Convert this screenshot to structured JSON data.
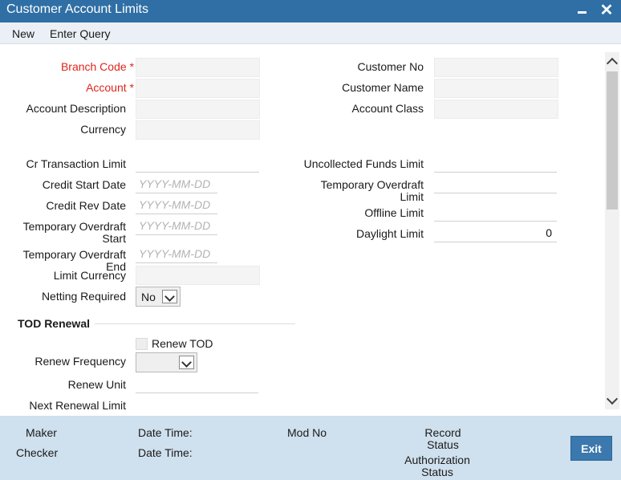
{
  "window": {
    "title": "Customer Account Limits",
    "minimize_icon": "minimize-icon",
    "close_icon": "close-icon",
    "close_glyph": "✕"
  },
  "toolbar": {
    "new_label": "New",
    "enter_query_label": "Enter Query"
  },
  "fields": {
    "branch_code": {
      "label": "Branch Code",
      "required_mark": "*",
      "value": ""
    },
    "account": {
      "label": "Account",
      "required_mark": "*",
      "value": ""
    },
    "account_description": {
      "label": "Account Description",
      "value": ""
    },
    "currency": {
      "label": "Currency",
      "value": ""
    },
    "customer_no": {
      "label": "Customer No",
      "value": ""
    },
    "customer_name": {
      "label": "Customer Name",
      "value": ""
    },
    "account_class": {
      "label": "Account Class",
      "value": ""
    },
    "cr_transaction_limit": {
      "label": "Cr Transaction Limit",
      "value": ""
    },
    "credit_start_date": {
      "label": "Credit Start Date",
      "placeholder": "YYYY-MM-DD"
    },
    "credit_rev_date": {
      "label": "Credit Rev Date",
      "placeholder": "YYYY-MM-DD"
    },
    "temporary_overdraft_start": {
      "label_line1": "Temporary Overdraft",
      "label_line2": "Start",
      "placeholder": "YYYY-MM-DD"
    },
    "temporary_overdraft_end": {
      "label": "Temporary Overdraft End",
      "placeholder": "YYYY-MM-DD"
    },
    "limit_currency": {
      "label": "Limit Currency",
      "value": ""
    },
    "netting_required": {
      "label": "Netting Required",
      "value": "No"
    },
    "uncollected_funds_limit": {
      "label": "Uncollected Funds Limit",
      "value": ""
    },
    "temporary_overdraft_limit": {
      "label_line1": "Temporary Overdraft",
      "label_line2": "Limit",
      "value": ""
    },
    "offline_limit": {
      "label": "Offline Limit",
      "value": ""
    },
    "daylight_limit": {
      "label": "Daylight Limit",
      "value": "0"
    }
  },
  "tod_renewal": {
    "section_title": "TOD Renewal",
    "renew_tod_label": "Renew TOD",
    "renew_tod_checked": false,
    "renew_frequency_label": "Renew Frequency",
    "renew_frequency_value": "",
    "renew_unit_label": "Renew Unit",
    "next_renewal_limit_label": "Next Renewal Limit"
  },
  "footer": {
    "maker_label": "Maker",
    "checker_label": "Checker",
    "date_time_label": "Date Time:",
    "mod_no_label": "Mod No",
    "record_status_line1": "Record",
    "record_status_line2": "Status",
    "auth_status_line1": "Authorization",
    "auth_status_line2": "Status",
    "exit_label": "Exit"
  },
  "colors": {
    "title_bar": "#2f6fa5",
    "required": "#e0241b",
    "footer": "#cfe0ee",
    "exit_button": "#3a78ad"
  }
}
